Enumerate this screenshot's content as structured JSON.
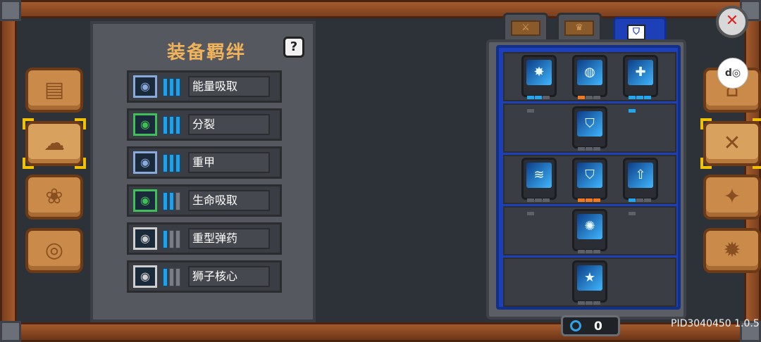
{
  "panel": {
    "title": "装备羁绊",
    "help_label": "?"
  },
  "bonds": [
    {
      "name": "能量吸取",
      "level": 3,
      "max": 3,
      "icon": "energy-orb-icon",
      "color": "#8ad"
    },
    {
      "name": "分裂",
      "level": 3,
      "max": 3,
      "icon": "split-arrows-icon",
      "color": "#3fbf5a"
    },
    {
      "name": "重甲",
      "level": 3,
      "max": 3,
      "icon": "armor-icon",
      "color": "#8ad"
    },
    {
      "name": "生命吸取",
      "level": 2,
      "max": 3,
      "icon": "life-drain-icon",
      "color": "#3fbf5a"
    },
    {
      "name": "重型弹药",
      "level": 1,
      "max": 3,
      "icon": "heavy-ammo-icon",
      "color": "#cfcfcf"
    },
    {
      "name": "狮子核心",
      "level": 1,
      "max": 3,
      "icon": "lion-core-icon",
      "color": "#cfcfcf"
    }
  ],
  "side_tabs_left": [
    {
      "icon": "book-icon",
      "glyph": "▤"
    },
    {
      "icon": "cloud-box-icon",
      "glyph": "☁",
      "selected": true
    },
    {
      "icon": "pawprint-icon",
      "glyph": "❀"
    },
    {
      "icon": "steering-wheel-icon",
      "glyph": "◎"
    }
  ],
  "side_tabs_right": [
    {
      "icon": "helmet-icon",
      "glyph": "⌂"
    },
    {
      "icon": "crossed-swords-icon",
      "glyph": "✕",
      "selected": true
    },
    {
      "icon": "compass-icon",
      "glyph": "✦"
    },
    {
      "icon": "gear-icon",
      "glyph": "✹"
    }
  ],
  "talent_tabs": [
    {
      "icon": "sword-tab-icon",
      "glyph": "⚔"
    },
    {
      "icon": "crown-tab-icon",
      "glyph": "♛"
    },
    {
      "icon": "shield-tab-icon",
      "glyph": "⛉",
      "active": true
    }
  ],
  "talents": [
    {
      "row": 0,
      "col": 0,
      "icon": "star-burst-icon",
      "glyph": "✸",
      "level": [
        1,
        1,
        0,
        0
      ],
      "accent": "blue"
    },
    {
      "row": 0,
      "col": 1,
      "icon": "shield-bash-icon",
      "glyph": "◍",
      "level": [
        1,
        0,
        0,
        0
      ],
      "accent": "orange"
    },
    {
      "row": 0,
      "col": 2,
      "icon": "heal-cross-icon",
      "glyph": "✚",
      "level": [
        1,
        1,
        1,
        1
      ],
      "accent": "blue"
    },
    {
      "row": 1,
      "col": 1,
      "icon": "shield-icon",
      "glyph": "⛉",
      "level": [
        0,
        0,
        0,
        0
      ],
      "accent": "blue"
    },
    {
      "row": 2,
      "col": 0,
      "icon": "slash-wave-icon",
      "glyph": "≋",
      "level": [
        0,
        0,
        0,
        0
      ],
      "accent": "blue"
    },
    {
      "row": 2,
      "col": 1,
      "icon": "shield-aura-icon",
      "glyph": "⛉",
      "level": [
        1,
        1,
        1,
        1
      ],
      "accent": "orange"
    },
    {
      "row": 2,
      "col": 2,
      "icon": "shield-up-icon",
      "glyph": "⇧",
      "level": [
        1,
        0,
        0,
        0
      ],
      "accent": "blue"
    },
    {
      "row": 3,
      "col": 1,
      "icon": "ground-burst-icon",
      "glyph": "✺",
      "level": [
        0,
        0,
        0,
        0
      ],
      "accent": "blue"
    },
    {
      "row": 4,
      "col": 1,
      "icon": "star-shield-icon",
      "glyph": "★",
      "level": [
        0,
        0,
        0,
        0
      ],
      "accent": "blue"
    }
  ],
  "currency": {
    "value": "0",
    "icon": "blue-swirl-icon"
  },
  "version_text": "PID3040450 1.0.5",
  "close_icon": "close-x-icon",
  "overlay_label": "d◎"
}
